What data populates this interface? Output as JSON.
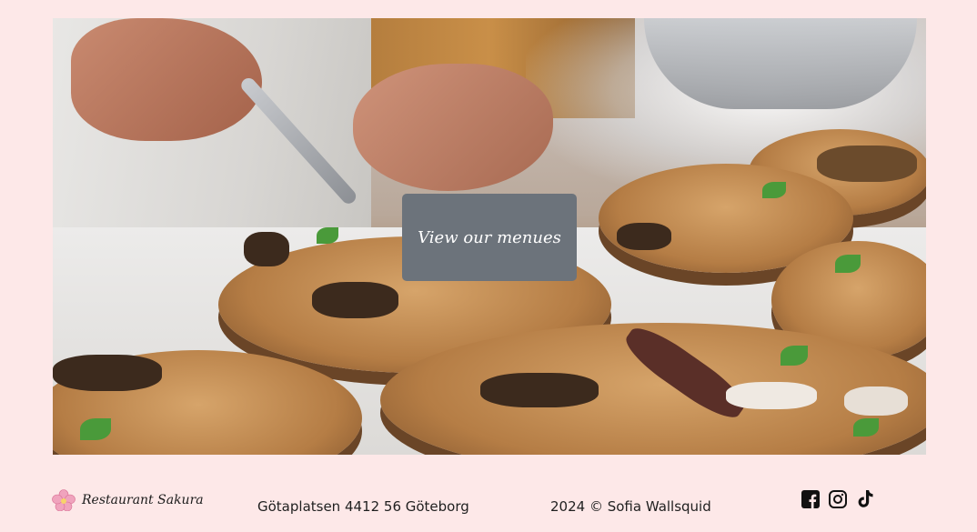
{
  "hero": {
    "cta_label": "View our menues"
  },
  "footer": {
    "brand": {
      "icon": "cherry-blossom-icon",
      "name": "Restaurant Sakura"
    },
    "address": "Götaplatsen 4412 56 Göteborg",
    "copyright": "2024 © Sofia Wallsquid",
    "socials": [
      {
        "name": "facebook-icon"
      },
      {
        "name": "instagram-icon"
      },
      {
        "name": "tiktok-icon"
      }
    ]
  },
  "colors": {
    "page_background": "#fde8e8",
    "button_background": "#6c737b",
    "text": "#1f1f1f"
  }
}
